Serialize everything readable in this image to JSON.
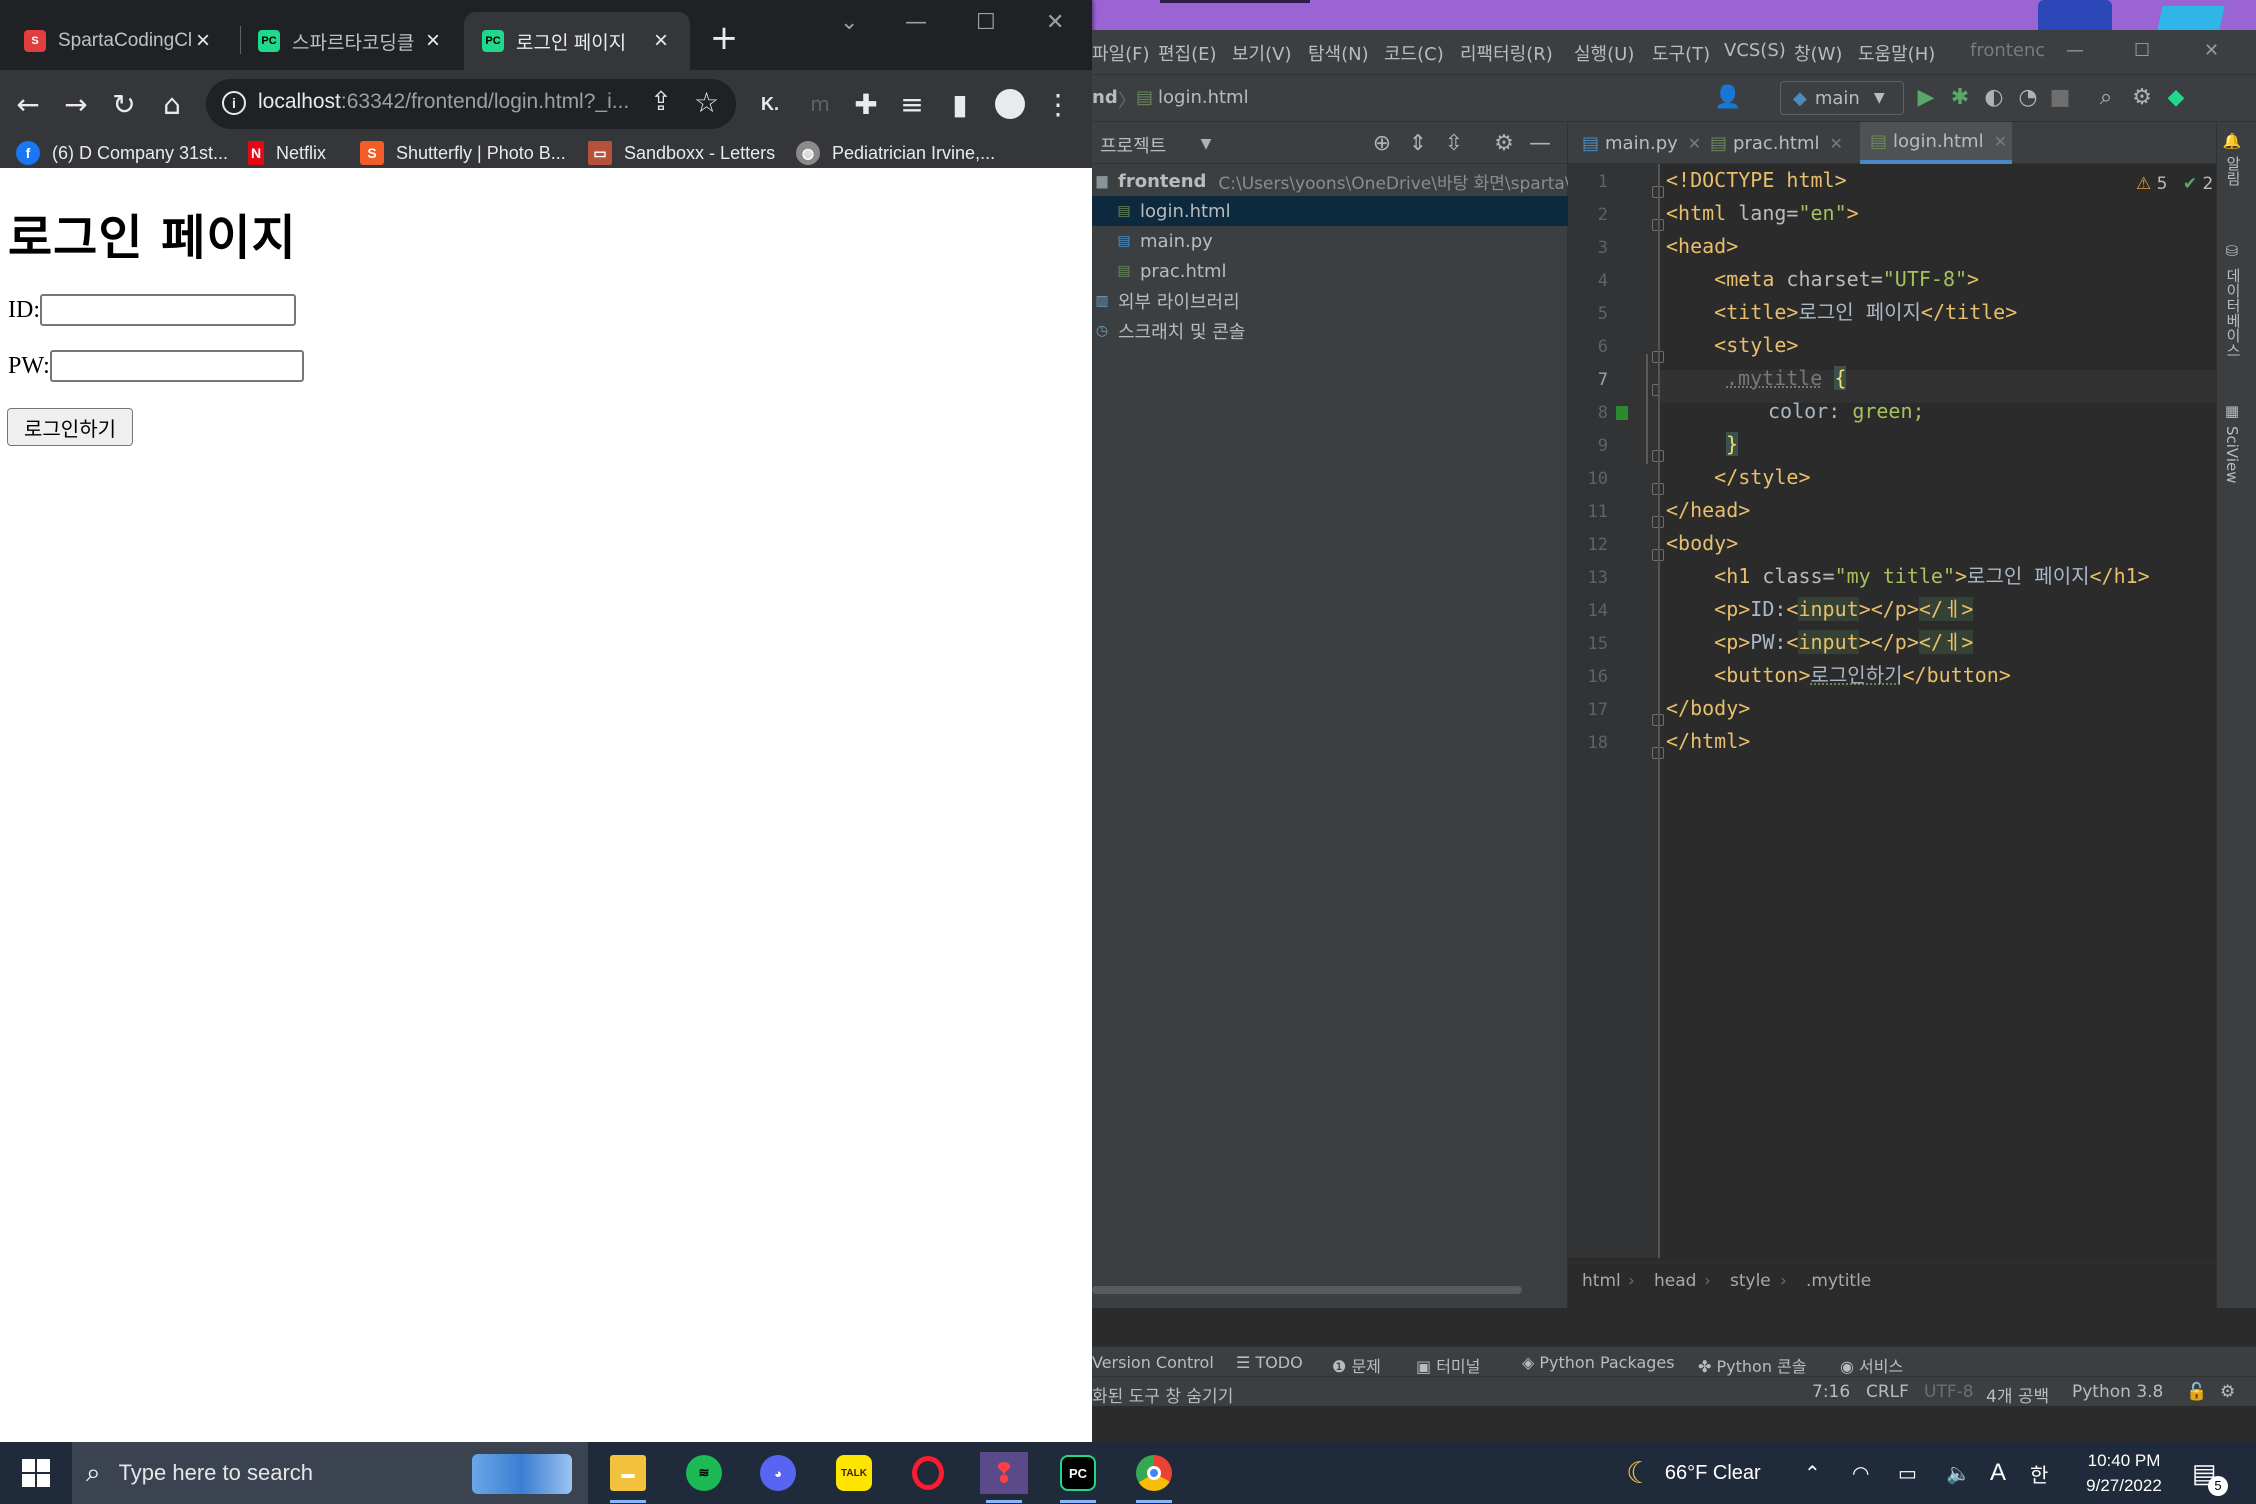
{
  "browser": {
    "tabs": [
      {
        "title": "SpartaCodingCl",
        "color": "#e03f3f",
        "glyph": "S"
      },
      {
        "title": "스파르타코딩클",
        "color": "#21d789",
        "glyph": "PC"
      },
      {
        "title": "로그인 페이지",
        "color": "#21d789",
        "glyph": "PC"
      }
    ],
    "url_host": "localhost",
    "url_rest": ":63342/frontend/login.html?_i...",
    "bookmarks": [
      {
        "label": "(6) D Company 31st...",
        "icon": "facebook-icon",
        "color": "#1877f2",
        "glyph": "f"
      },
      {
        "label": "Netflix",
        "icon": "netflix-icon",
        "color": "#e50914",
        "glyph": "N"
      },
      {
        "label": "Shutterfly | Photo B...",
        "icon": "shutterfly-icon",
        "color": "#f25c26",
        "glyph": "S"
      },
      {
        "label": "Sandboxx - Letters",
        "icon": "sandboxx-icon",
        "color": "#b5513d",
        "glyph": "▭"
      },
      {
        "label": "Pediatrician Irvine,...",
        "icon": "globe-icon",
        "color": "#8a8a8a",
        "glyph": "◍"
      }
    ],
    "extension_k": "K."
  },
  "page": {
    "heading": "로그인 페이지",
    "id_label": "ID:",
    "pw_label": "PW:",
    "login_button": "로그인하기"
  },
  "ide": {
    "menu": [
      "파일(F)",
      "편집(E)",
      "보기(V)",
      "탐색(N)",
      "코드(C)",
      "리팩터링(R)",
      "실행(U)",
      "도구(T)",
      "VCS(S)",
      "창(W)",
      "도움말(H)"
    ],
    "window_title": "frontenc",
    "nav_project": "nd",
    "nav_file": "login.html",
    "run_config": "main",
    "project_label": "프로젝트",
    "tree": {
      "root": "frontend",
      "root_path": "C:\\Users\\yoons\\OneDrive\\바탕 화면\\sparta\\fro",
      "files": [
        "login.html",
        "main.py",
        "prac.html"
      ],
      "ext_libs": "외부 라이브러리",
      "scratches": "스크래치 및 콘솔"
    },
    "editor_tabs": [
      "main.py",
      "prac.html",
      "login.html"
    ],
    "problems": {
      "warnings": "5",
      "ok": "2"
    },
    "line_numbers": [
      "1",
      "2",
      "3",
      "4",
      "5",
      "6",
      "7",
      "8",
      "9",
      "10",
      "11",
      "12",
      "13",
      "14",
      "15",
      "16",
      "17",
      "18"
    ],
    "code": {
      "l1": "<!DOCTYPE html>",
      "l2_open": "<html ",
      "l2_attr": "lang=",
      "l2_val": "\"en\"",
      "l2_close": ">",
      "l3": "<head>",
      "l4_open": "    <meta ",
      "l4_attr": "charset=",
      "l4_val": "\"UTF-8\"",
      "l4_close": ">",
      "l5_open": "    <title>",
      "l5_text": "로그인 페이지",
      "l5_close": "</title>",
      "l6": "    <style>",
      "l7_sel": ".mytitle",
      "l7_brace": "{",
      "l8_prop": "color",
      "l8_colon": ": ",
      "l8_val": "green;",
      "l9_brace": "}",
      "l10": "    </style>",
      "l11": "</head>",
      "l12": "<body>",
      "l13_open": "    <h1 ",
      "l13_attr": "class=",
      "l13_val": "\"my title\"",
      "l13_gt": ">",
      "l13_text": "로그인 페이지",
      "l13_close": "</h1>",
      "l14_a": "    <p>",
      "l14_t": "ID:",
      "l14_b": "<",
      "l14_i": "input",
      "l14_c": "></p>",
      "l14_d": "</ㅔ>",
      "l15_a": "    <p>",
      "l15_t": "PW:",
      "l15_b": "<",
      "l15_i": "input",
      "l15_c": "></p>",
      "l15_d": "</ㅔ>",
      "l16_a": "    <button>",
      "l16_t": "로그인하기",
      "l16_c": "</button>",
      "l17": "</body>",
      "l18": "</html>"
    },
    "breadcrumb": [
      "html",
      "head",
      "style",
      ".mytitle"
    ],
    "bottom_tools": [
      "Version Control",
      "TODO",
      "문제",
      "터미널",
      "Python Packages",
      "Python 콘솔",
      "서비스"
    ],
    "status_left": "화된 도구 창 숨기기",
    "status_right": {
      "pos": "7:16",
      "eol": "CRLF",
      "enc": "UTF-8",
      "indent": "4개 공백",
      "interp": "Python 3.8"
    },
    "right_side": [
      "알림",
      "데이터베이스",
      "SciView"
    ]
  },
  "taskbar": {
    "search_placeholder": "Type here to search",
    "weather": "66°F  Clear",
    "ime_lang": "A",
    "ime_kor": "한",
    "time": "10:40 PM",
    "date": "9/27/2022",
    "notif_count": "5"
  }
}
